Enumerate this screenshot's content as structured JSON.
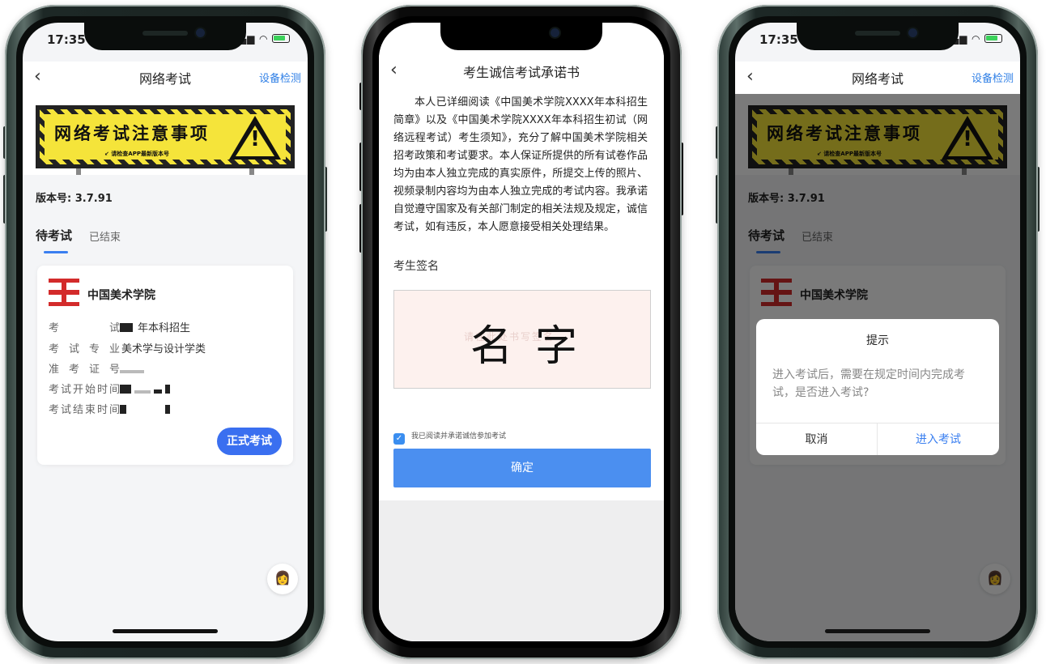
{
  "status": {
    "time": "17:35"
  },
  "exam_page": {
    "nav": {
      "back_icon": "‹",
      "title": "网络考试",
      "device_check": "设备检测"
    },
    "banner": {
      "heading": "网络考试注意事项",
      "subtext": "↙ 请检查APP最新版本号",
      "icon": "warning-triangle-icon"
    },
    "version": "版本号: 3.7.91",
    "tabs": {
      "pending": "待考试",
      "ended": "已结束"
    },
    "card": {
      "school": "中国美术学院",
      "rows": [
        {
          "label": "考 试",
          "value": "年本科招生"
        },
        {
          "label": "考试专业",
          "value": "美术学与设计学类"
        },
        {
          "label": "准考证号",
          "value": ""
        },
        {
          "label": "考试开始时间",
          "value": ""
        },
        {
          "label": "考试结束时间",
          "value": ""
        }
      ],
      "start_button": "正式考试"
    },
    "service_icon": "customer-service-icon"
  },
  "pledge_page": {
    "nav": {
      "back_icon": "‹",
      "title": "考生诚信考试承诺书"
    },
    "paragraph": "本人已详细阅读《中国美术学院XXXX年本科招生简章》以及《中国美术学院XXXX年本科招生初试（网络远程考试）考生须知》，充分了解中国美术学院相关招考政策和考试要求。本人保证所提供的所有试卷作品均为由本人独立完成的真实原件，所提交上传的照片、视频录制内容均为由本人独立完成的考试内容。我承诺自觉遵守国家及有关部门制定的相关法规及规定，诚信考试，如有违反，本人愿意接受相关处理结果。",
    "signature_label": "考生签名",
    "signature": "名字",
    "signature_watermark": "请在此处书写签名",
    "agree_text": "我已阅读并承诺诚信参加考试",
    "confirm_button": "确定"
  },
  "dialog": {
    "title": "提示",
    "message": "进入考试后，需要在规定时间内完成考试，是否进入考试?",
    "cancel": "取消",
    "enter": "进入考试"
  },
  "colors": {
    "accent": "#3a7ff0",
    "button": "#3a6ff0",
    "sign_yellow": "#f5e43a",
    "logo_red": "#d32b2b"
  }
}
